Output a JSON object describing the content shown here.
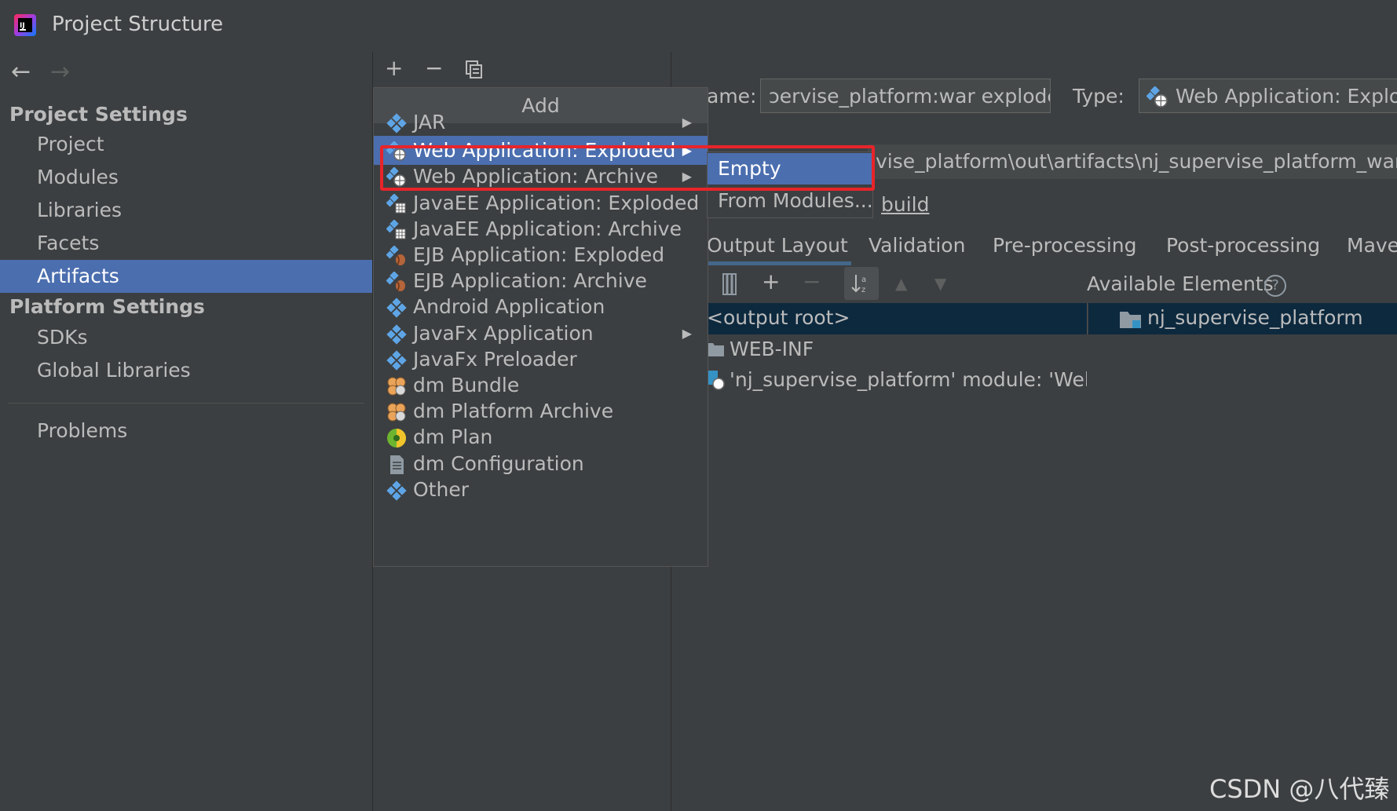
{
  "window": {
    "title": "Project Structure"
  },
  "sidebar": {
    "project_settings_title": "Project Settings",
    "project_items": [
      "Project",
      "Modules",
      "Libraries",
      "Facets",
      "Artifacts"
    ],
    "selected_item": "Artifacts",
    "platform_settings_title": "Platform Settings",
    "platform_items": [
      "SDKs",
      "Global Libraries"
    ],
    "problems_label": "Problems"
  },
  "artifact": {
    "name_label": "ame:",
    "name_value": "ɔervise_platform:war exploded",
    "type_label": "Type:",
    "type_value": "Web Application: Explode",
    "output_dir_value": "vise_platform\\out\\artifacts\\nj_supervise_platform_war_expl",
    "build_label": "build",
    "tabs": [
      "Output Layout",
      "Validation",
      "Pre-processing",
      "Post-processing",
      "Mave"
    ],
    "active_tab": "Output Layout",
    "available_elements_label": "Available Elements",
    "tree": {
      "root": "<output root>",
      "items": [
        "WEB-INF",
        "'nj_supervise_platform' module: 'Web' fa"
      ]
    },
    "available_root": "nj_supervise_platform"
  },
  "add_menu": {
    "header": "Add",
    "items": [
      {
        "label": "JAR",
        "submenu": true,
        "icon": "artifact-icon"
      },
      {
        "label": "Web Application: Exploded",
        "submenu": true,
        "icon": "web-artifact-icon",
        "highlighted": true
      },
      {
        "label": "Web Application: Archive",
        "submenu": true,
        "icon": "web-artifact-icon"
      },
      {
        "label": "JavaEE Application: Exploded",
        "submenu": false,
        "icon": "javaee-artifact-icon"
      },
      {
        "label": "JavaEE Application: Archive",
        "submenu": false,
        "icon": "javaee-artifact-icon"
      },
      {
        "label": "EJB Application: Exploded",
        "submenu": false,
        "icon": "ejb-artifact-icon"
      },
      {
        "label": "EJB Application: Archive",
        "submenu": false,
        "icon": "ejb-artifact-icon"
      },
      {
        "label": "Android Application",
        "submenu": false,
        "icon": "artifact-icon"
      },
      {
        "label": "JavaFx Application",
        "submenu": true,
        "icon": "artifact-icon"
      },
      {
        "label": "JavaFx Preloader",
        "submenu": false,
        "icon": "artifact-icon"
      },
      {
        "label": "dm Bundle",
        "submenu": false,
        "icon": "dm-bundle-icon"
      },
      {
        "label": "dm Platform Archive",
        "submenu": false,
        "icon": "dm-bundle-icon"
      },
      {
        "label": "dm Plan",
        "submenu": false,
        "icon": "dm-plan-icon"
      },
      {
        "label": "dm Configuration",
        "submenu": false,
        "icon": "document-icon"
      },
      {
        "label": "Other",
        "submenu": false,
        "icon": "artifact-icon"
      }
    ]
  },
  "submenu": {
    "items": [
      "Empty",
      "From Modules..."
    ],
    "highlighted": "Empty"
  },
  "watermark": "CSDN @八代臻",
  "colors": {
    "background": "#3c3f41",
    "selection": "#4b6eaf",
    "tree_selection": "#0d293e",
    "annotation_red": "#e8242a",
    "artifact_blue": "#5ea5e6"
  }
}
